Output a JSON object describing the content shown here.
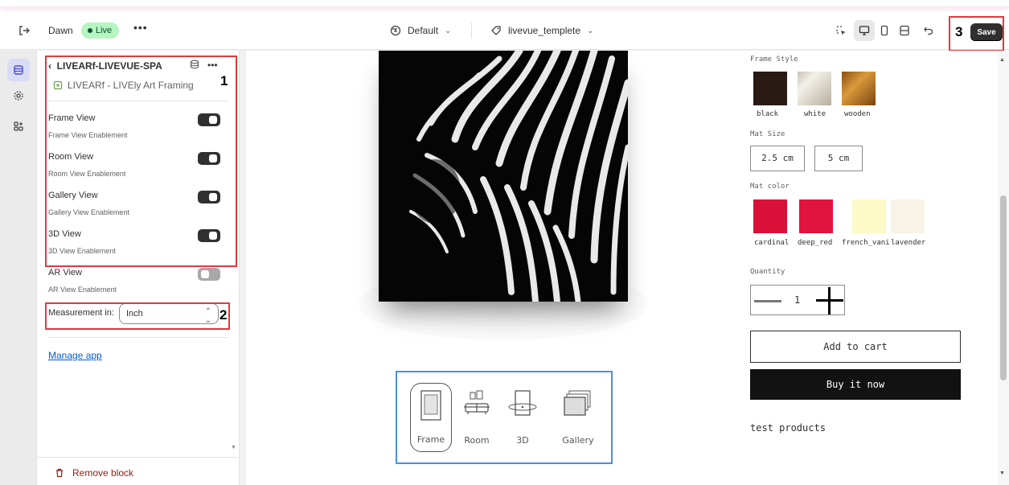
{
  "topbar": {
    "store_name": "Dawn",
    "status_badge": "Live",
    "more": "•••",
    "theme_label": "Default",
    "template_label": "livevue_templete",
    "save_label": "Save"
  },
  "panel": {
    "title": "LIVEARf-LIVEVUE-SPA",
    "app_name": "LIVEARf - LIVEly Art Framing",
    "settings": [
      {
        "label": "Frame View",
        "desc": "Frame View Enablement",
        "on": true
      },
      {
        "label": "Room View",
        "desc": "Room View Enablement",
        "on": true
      },
      {
        "label": "Gallery View",
        "desc": "Gallery View Enablement",
        "on": true
      },
      {
        "label": "3D View",
        "desc": "3D View Enablement",
        "on": true
      },
      {
        "label": "AR View",
        "desc": "AR View Enablement",
        "on": false
      }
    ],
    "measurement_label": "Measurement in:",
    "measurement_value": "Inch",
    "manage_link": "Manage app",
    "remove_block": "Remove block"
  },
  "annotations": [
    "1",
    "2",
    "3"
  ],
  "preview": {
    "view_options": [
      {
        "label": "Frame",
        "selected": true
      },
      {
        "label": "Room",
        "selected": false
      },
      {
        "label": "3D",
        "selected": false
      },
      {
        "label": "Gallery",
        "selected": false
      }
    ],
    "frame_style_label": "Frame Style",
    "frame_styles": [
      {
        "name": "black",
        "color": "#2a1a14"
      },
      {
        "name": "white",
        "color": "#e8e4dc"
      },
      {
        "name": "wooden",
        "color": "#b8741e"
      }
    ],
    "mat_size_label": "Mat Size",
    "mat_sizes": [
      "2.5 cm",
      "5 cm"
    ],
    "mat_color_label": "Mat color",
    "mat_colors": [
      {
        "name": "cardinal",
        "color": "#db1038"
      },
      {
        "name": "deep_red",
        "color": "#e1133f"
      },
      {
        "name": "french_vani",
        "color": "#fdfac8"
      },
      {
        "name": "lavender",
        "color": "#f8f3e6"
      }
    ],
    "quantity_label": "Quantity",
    "quantity_value": "1",
    "add_to_cart": "Add to cart",
    "buy_now": "Buy it now",
    "product_description": "test products"
  }
}
